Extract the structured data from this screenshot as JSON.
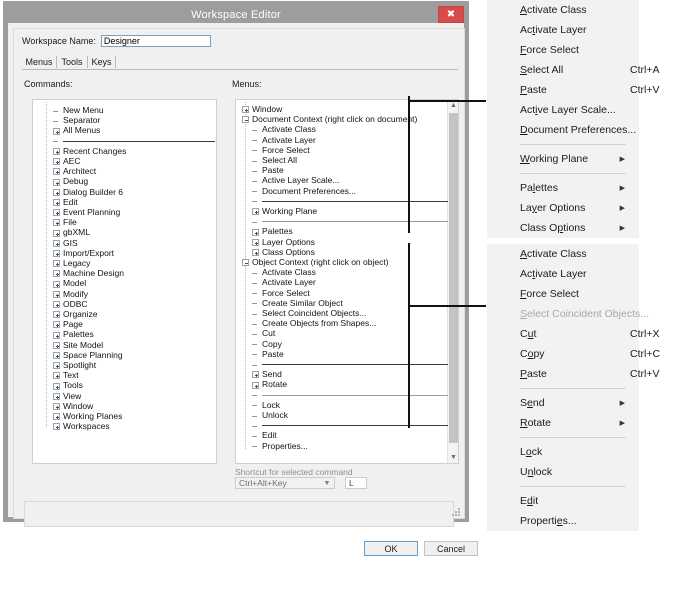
{
  "dialog": {
    "title": "Workspace Editor",
    "close_icon": "close-icon",
    "workspace_name_label": "Workspace Name:",
    "workspace_name_value": "Designer",
    "tabs": [
      {
        "label": "Menus",
        "selected": true
      },
      {
        "label": "Tools",
        "selected": false
      },
      {
        "label": "Keys",
        "selected": false
      }
    ],
    "commands_caption": "Commands:",
    "menus_caption": "Menus:",
    "shortcut_caption": "Shortcut for selected command",
    "shortcut_modifier": "Ctrl+Alt+Key",
    "shortcut_key": "L",
    "ok_label": "OK",
    "cancel_label": "Cancel"
  },
  "commands_tree": [
    {
      "label": "New Menu",
      "indent": 1,
      "glyph": "dash"
    },
    {
      "label": "Separator",
      "indent": 1,
      "glyph": "dash"
    },
    {
      "label": "All Menus",
      "indent": 1,
      "glyph": "plus"
    },
    {
      "label": "",
      "indent": 1,
      "glyph": "dash",
      "rule": "dark"
    },
    {
      "label": "Recent Changes",
      "indent": 1,
      "glyph": "plus"
    },
    {
      "label": "AEC",
      "indent": 1,
      "glyph": "plus"
    },
    {
      "label": "Architect",
      "indent": 1,
      "glyph": "plus"
    },
    {
      "label": "Debug",
      "indent": 1,
      "glyph": "plus"
    },
    {
      "label": "Dialog Builder 6",
      "indent": 1,
      "glyph": "plus"
    },
    {
      "label": "Edit",
      "indent": 1,
      "glyph": "plus"
    },
    {
      "label": "Event Planning",
      "indent": 1,
      "glyph": "plus"
    },
    {
      "label": "File",
      "indent": 1,
      "glyph": "plus"
    },
    {
      "label": "gbXML",
      "indent": 1,
      "glyph": "plus"
    },
    {
      "label": "GIS",
      "indent": 1,
      "glyph": "plus"
    },
    {
      "label": "Import/Export",
      "indent": 1,
      "glyph": "plus"
    },
    {
      "label": "Legacy",
      "indent": 1,
      "glyph": "plus"
    },
    {
      "label": "Machine Design",
      "indent": 1,
      "glyph": "plus"
    },
    {
      "label": "Model",
      "indent": 1,
      "glyph": "plus"
    },
    {
      "label": "Modify",
      "indent": 1,
      "glyph": "plus"
    },
    {
      "label": "ODBC",
      "indent": 1,
      "glyph": "plus"
    },
    {
      "label": "Organize",
      "indent": 1,
      "glyph": "plus"
    },
    {
      "label": "Page",
      "indent": 1,
      "glyph": "plus"
    },
    {
      "label": "Palettes",
      "indent": 1,
      "glyph": "plus"
    },
    {
      "label": "Site Model",
      "indent": 1,
      "glyph": "plus"
    },
    {
      "label": "Space Planning",
      "indent": 1,
      "glyph": "plus"
    },
    {
      "label": "Spotlight",
      "indent": 1,
      "glyph": "plus"
    },
    {
      "label": "Text",
      "indent": 1,
      "glyph": "plus"
    },
    {
      "label": "Tools",
      "indent": 1,
      "glyph": "plus"
    },
    {
      "label": "View",
      "indent": 1,
      "glyph": "plus"
    },
    {
      "label": "Window",
      "indent": 1,
      "glyph": "plus"
    },
    {
      "label": "Working Planes",
      "indent": 1,
      "glyph": "plus"
    },
    {
      "label": "Workspaces",
      "indent": 1,
      "glyph": "plus"
    }
  ],
  "menus_tree": [
    {
      "label": "Window",
      "indent": 0,
      "glyph": "plus"
    },
    {
      "label": "Document Context (right click on document)",
      "indent": 0,
      "glyph": "minus"
    },
    {
      "label": "Activate Class",
      "indent": 1,
      "glyph": "dash"
    },
    {
      "label": "Activate Layer",
      "indent": 1,
      "glyph": "dash"
    },
    {
      "label": "Force Select",
      "indent": 1,
      "glyph": "dash"
    },
    {
      "label": "Select All",
      "indent": 1,
      "glyph": "dash"
    },
    {
      "label": "Paste",
      "indent": 1,
      "glyph": "dash"
    },
    {
      "label": "Active Layer Scale...",
      "indent": 1,
      "glyph": "dash"
    },
    {
      "label": "Document Preferences...",
      "indent": 1,
      "glyph": "dash"
    },
    {
      "label": "",
      "indent": 1,
      "glyph": "dash",
      "rule": "dark"
    },
    {
      "label": "Working Plane",
      "indent": 1,
      "glyph": "plus"
    },
    {
      "label": "",
      "indent": 1,
      "glyph": "dash",
      "rule": "grey"
    },
    {
      "label": "Palettes",
      "indent": 1,
      "glyph": "plus"
    },
    {
      "label": "Layer Options",
      "indent": 1,
      "glyph": "plus"
    },
    {
      "label": "Class Options",
      "indent": 1,
      "glyph": "plus"
    },
    {
      "label": "Object Context (right click on object)",
      "indent": 0,
      "glyph": "minus"
    },
    {
      "label": "Activate Class",
      "indent": 1,
      "glyph": "dash"
    },
    {
      "label": "Activate Layer",
      "indent": 1,
      "glyph": "dash"
    },
    {
      "label": "Force Select",
      "indent": 1,
      "glyph": "dash"
    },
    {
      "label": "Create Similar Object",
      "indent": 1,
      "glyph": "dash"
    },
    {
      "label": "Select Coincident Objects...",
      "indent": 1,
      "glyph": "dash"
    },
    {
      "label": "Create Objects from Shapes...",
      "indent": 1,
      "glyph": "dash"
    },
    {
      "label": "Cut",
      "indent": 1,
      "glyph": "dash"
    },
    {
      "label": "Copy",
      "indent": 1,
      "glyph": "dash"
    },
    {
      "label": "Paste",
      "indent": 1,
      "glyph": "dash"
    },
    {
      "label": "",
      "indent": 1,
      "glyph": "dash",
      "rule": "dark"
    },
    {
      "label": "Send",
      "indent": 1,
      "glyph": "plus"
    },
    {
      "label": "Rotate",
      "indent": 1,
      "glyph": "plus"
    },
    {
      "label": "",
      "indent": 1,
      "glyph": "dash",
      "rule": "grey"
    },
    {
      "label": "Lock",
      "indent": 1,
      "glyph": "dash"
    },
    {
      "label": "Unlock",
      "indent": 1,
      "glyph": "dash"
    },
    {
      "label": "",
      "indent": 1,
      "glyph": "dash",
      "rule": "dark"
    },
    {
      "label": "Edit",
      "indent": 1,
      "glyph": "dash"
    },
    {
      "label": "Properties...",
      "indent": 1,
      "glyph": "dash"
    }
  ],
  "document_context_menu": {
    "name": "Document Context menu",
    "items": [
      {
        "label": "Activate Class",
        "mnemonic": 0,
        "accel": "",
        "submenu": false
      },
      {
        "label": "Activate Layer",
        "mnemonic": 2,
        "accel": "",
        "submenu": false
      },
      {
        "label": "Force Select",
        "mnemonic": 0,
        "accel": "",
        "submenu": false
      },
      {
        "label": "Select All",
        "mnemonic": 0,
        "accel": "Ctrl+A",
        "submenu": false
      },
      {
        "label": "Paste",
        "mnemonic": 0,
        "accel": "Ctrl+V",
        "submenu": false
      },
      {
        "label": "Active Layer Scale...",
        "mnemonic": 3,
        "accel": "",
        "submenu": false
      },
      {
        "label": "Document Preferences...",
        "mnemonic": 0,
        "accel": "",
        "submenu": false
      },
      {
        "separator": true
      },
      {
        "label": "Working Plane",
        "mnemonic": 0,
        "accel": "",
        "submenu": true
      },
      {
        "separator": true
      },
      {
        "label": "Palettes",
        "mnemonic": 2,
        "accel": "",
        "submenu": true
      },
      {
        "label": "Layer Options",
        "mnemonic": 2,
        "accel": "",
        "submenu": true
      },
      {
        "label": "Class Options",
        "mnemonic": 7,
        "accel": "",
        "submenu": true
      }
    ]
  },
  "object_context_menu": {
    "name": "Object Context menu",
    "items": [
      {
        "label": "Activate Class",
        "mnemonic": 0,
        "accel": "",
        "submenu": false
      },
      {
        "label": "Activate Layer",
        "mnemonic": 2,
        "accel": "",
        "submenu": false
      },
      {
        "label": "Force Select",
        "mnemonic": 0,
        "accel": "",
        "submenu": false
      },
      {
        "label": "Select Coincident Objects...",
        "mnemonic": 0,
        "accel": "",
        "submenu": false,
        "disabled": true
      },
      {
        "label": "Cut",
        "mnemonic": 1,
        "accel": "Ctrl+X",
        "submenu": false
      },
      {
        "label": "Copy",
        "mnemonic": 1,
        "accel": "Ctrl+C",
        "submenu": false
      },
      {
        "label": "Paste",
        "mnemonic": 0,
        "accel": "Ctrl+V",
        "submenu": false
      },
      {
        "separator": true
      },
      {
        "label": "Send",
        "mnemonic": 1,
        "accel": "",
        "submenu": true
      },
      {
        "label": "Rotate",
        "mnemonic": 0,
        "accel": "",
        "submenu": true
      },
      {
        "separator": true
      },
      {
        "label": "Lock",
        "mnemonic": 1,
        "accel": "",
        "submenu": false
      },
      {
        "label": "Unlock",
        "mnemonic": 1,
        "accel": "",
        "submenu": false
      },
      {
        "separator": true
      },
      {
        "label": "Edit",
        "mnemonic": 1,
        "accel": "",
        "submenu": false
      },
      {
        "label": "Properties...",
        "mnemonic": 8,
        "accel": "",
        "submenu": false
      }
    ]
  },
  "colors": {
    "titlebar": "#9d9d9d",
    "close_button": "#d64b4b",
    "dialog_face": "#f0f0f0",
    "menu_face": "#f2f2f0",
    "accent_focus": "#5aa0df",
    "annotation_line": "#111111"
  }
}
